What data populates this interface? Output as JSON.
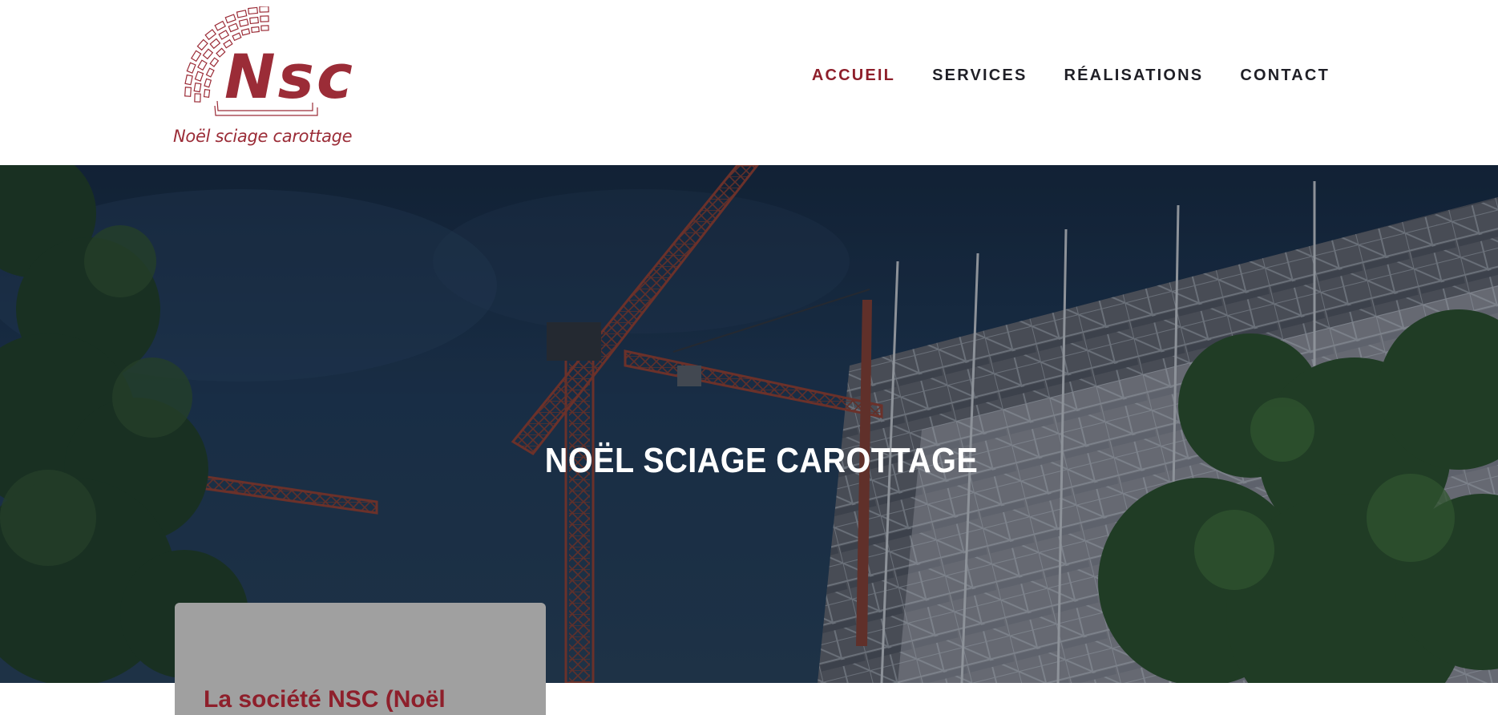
{
  "header": {
    "logo": {
      "wordmark": "Nsc",
      "tagline": "Noël sciage carottage"
    },
    "nav": {
      "items": [
        {
          "label": "ACCUEIL",
          "active": true
        },
        {
          "label": "SERVICES",
          "active": false
        },
        {
          "label": "RÉALISATIONS",
          "active": false
        },
        {
          "label": "CONTACT",
          "active": false
        }
      ]
    }
  },
  "hero": {
    "title": "NOËL SCIAGE CAROTTAGE",
    "image": "construction-cranes-scaffolding-photo"
  },
  "about_card": {
    "title_partial": "La société NSC (Noël"
  },
  "colors": {
    "brand": "#9b2c37",
    "nav_active": "#8e1f2b",
    "nav_text": "#1f1f26",
    "card_bg": "#a0a0a0"
  }
}
